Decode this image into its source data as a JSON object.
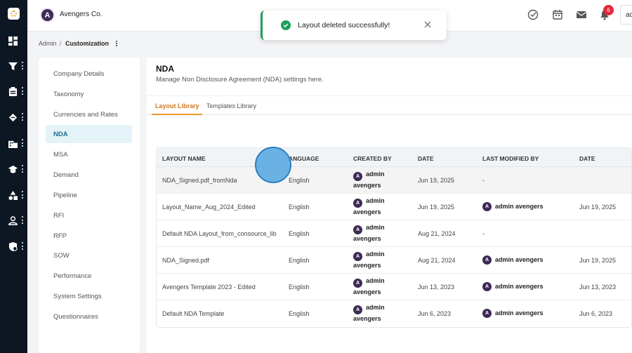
{
  "app": {
    "brand_name": "Avengers Co.",
    "brand_initial": "A",
    "user_initials": "ac",
    "notification_count": "6",
    "accent_color": "#e89b2f",
    "active_menu_color": "#1a6f8c",
    "success_color": "#1e9e5b"
  },
  "rail": {
    "icons": [
      "logo-icon",
      "dashboard-icon",
      "funnel-icon",
      "clipboard-icon",
      "handshake-icon",
      "building-icon",
      "graduation-cap-icon",
      "shapes-icon",
      "user-icon",
      "admin-settings-icon"
    ]
  },
  "header": {
    "icons": [
      "check-circle-icon",
      "calendar-icon",
      "mail-icon",
      "bell-icon"
    ]
  },
  "toast": {
    "message": "Layout deleted successfully!"
  },
  "breadcrumb": {
    "root": "Admin",
    "separator": "/",
    "current": "Customization"
  },
  "menu": {
    "items": [
      {
        "label": "Company Details"
      },
      {
        "label": "Taxonomy"
      },
      {
        "label": "Currencies and Rates"
      },
      {
        "label": "NDA"
      },
      {
        "label": "MSA"
      },
      {
        "label": "Demand"
      },
      {
        "label": "Pipeline"
      },
      {
        "label": "RFI"
      },
      {
        "label": "RFP"
      },
      {
        "label": "SOW"
      },
      {
        "label": "Performance"
      },
      {
        "label": "System Settings"
      },
      {
        "label": "Questionnaires"
      }
    ],
    "active": "NDA"
  },
  "page": {
    "title": "NDA",
    "subtitle": "Manage Non Disclosure Agreement (NDA) settings here."
  },
  "tabs": [
    {
      "label": "Layout Library"
    },
    {
      "label": "Templates Library"
    }
  ],
  "table": {
    "columns": [
      "LAYOUT NAME",
      "LANGUAGE",
      "CREATED BY",
      "DATE",
      "LAST MODIFIED BY",
      "DATE"
    ],
    "visible_language_header": "ANGUAGE",
    "rows": [
      {
        "name": "NDA_Signed.pdf_fromNda",
        "language": "English",
        "creator_first": "admin",
        "creator_last": "avengers",
        "date": "Jun 19, 2025",
        "modified_by": "-",
        "modified_date": ""
      },
      {
        "name": "Layout_Name_Aug_2024_Edited",
        "language": "English",
        "creator_first": "admin",
        "creator_last": "avengers",
        "date": "Jun 19, 2025",
        "modified_by": "admin avengers",
        "modified_date": "Jun 19, 2025"
      },
      {
        "name": "Default NDA Layout_from_consource_lib",
        "language": "English",
        "creator_first": "admin",
        "creator_last": "avengers",
        "date": "Aug 21, 2024",
        "modified_by": "-",
        "modified_date": ""
      },
      {
        "name": "NDA_Signed.pdf",
        "language": "English",
        "creator_first": "admin",
        "creator_last": "avengers",
        "date": "Aug 21, 2024",
        "modified_by": "admin avengers",
        "modified_date": "Jun 19, 2025"
      },
      {
        "name": "Avengers Template 2023 - Edited",
        "language": "English",
        "creator_first": "admin",
        "creator_last": "avengers",
        "date": "Jun 13, 2023",
        "modified_by": "admin avengers",
        "modified_date": "Jun 13, 2023"
      },
      {
        "name": "Default NDA Template",
        "language": "English",
        "creator_first": "admin",
        "creator_last": "avengers",
        "date": "Jun 6, 2023",
        "modified_by": "admin avengers",
        "modified_date": "Jun 6, 2023"
      }
    ]
  }
}
